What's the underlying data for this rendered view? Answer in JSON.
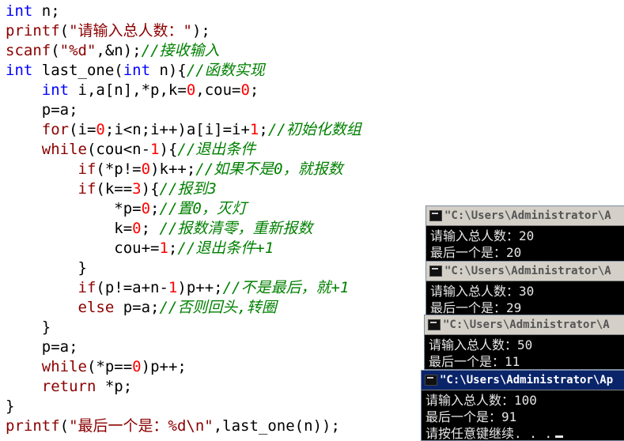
{
  "code_lines": [
    [
      {
        "t": "int",
        "c": "kw"
      },
      {
        "t": " n;",
        "c": "op"
      }
    ],
    [
      {
        "t": "printf",
        "c": "fn"
      },
      {
        "t": "(",
        "c": "op"
      },
      {
        "t": "\"请输入总人数：\"",
        "c": "str"
      },
      {
        "t": ");",
        "c": "op"
      }
    ],
    [
      {
        "t": "scanf",
        "c": "fn"
      },
      {
        "t": "(",
        "c": "op"
      },
      {
        "t": "\"%d\"",
        "c": "str"
      },
      {
        "t": ",&n);",
        "c": "op"
      },
      {
        "t": "//接收输入",
        "c": "cmt"
      }
    ],
    [
      {
        "t": "int",
        "c": "kw"
      },
      {
        "t": " last_one(",
        "c": "op"
      },
      {
        "t": "int",
        "c": "kw"
      },
      {
        "t": " n){",
        "c": "op"
      },
      {
        "t": "//函数实现",
        "c": "cmt"
      }
    ],
    [
      {
        "t": "    ",
        "c": "op"
      },
      {
        "t": "int",
        "c": "kw"
      },
      {
        "t": " i,a[n],*p,k=",
        "c": "op"
      },
      {
        "t": "0",
        "c": "num"
      },
      {
        "t": ",cou=",
        "c": "op"
      },
      {
        "t": "0",
        "c": "num"
      },
      {
        "t": ";",
        "c": "op"
      }
    ],
    [
      {
        "t": "    p=a;",
        "c": "op"
      }
    ],
    [
      {
        "t": "    ",
        "c": "op"
      },
      {
        "t": "for",
        "c": "fn"
      },
      {
        "t": "(i=",
        "c": "op"
      },
      {
        "t": "0",
        "c": "num"
      },
      {
        "t": ";i<n;i++)a[i]=i+",
        "c": "op"
      },
      {
        "t": "1",
        "c": "num"
      },
      {
        "t": ";",
        "c": "op"
      },
      {
        "t": "//初始化数组",
        "c": "cmt"
      }
    ],
    [
      {
        "t": "    ",
        "c": "op"
      },
      {
        "t": "while",
        "c": "fn"
      },
      {
        "t": "(cou<n-",
        "c": "op"
      },
      {
        "t": "1",
        "c": "num"
      },
      {
        "t": "){",
        "c": "op"
      },
      {
        "t": "//退出条件",
        "c": "cmt"
      }
    ],
    [
      {
        "t": "        ",
        "c": "op"
      },
      {
        "t": "if",
        "c": "fn"
      },
      {
        "t": "(*p!=",
        "c": "op"
      },
      {
        "t": "0",
        "c": "num"
      },
      {
        "t": ")k++;",
        "c": "op"
      },
      {
        "t": "//如果不是0，就报数",
        "c": "cmt"
      }
    ],
    [
      {
        "t": "        ",
        "c": "op"
      },
      {
        "t": "if",
        "c": "fn"
      },
      {
        "t": "(k==",
        "c": "op"
      },
      {
        "t": "3",
        "c": "num"
      },
      {
        "t": "){",
        "c": "op"
      },
      {
        "t": "//报到3",
        "c": "cmt"
      }
    ],
    [
      {
        "t": "            *p=",
        "c": "op"
      },
      {
        "t": "0",
        "c": "num"
      },
      {
        "t": ";",
        "c": "op"
      },
      {
        "t": "//置0，灭灯",
        "c": "cmt"
      }
    ],
    [
      {
        "t": "            k=",
        "c": "op"
      },
      {
        "t": "0",
        "c": "num"
      },
      {
        "t": "; ",
        "c": "op"
      },
      {
        "t": "//报数清零，重新报数",
        "c": "cmt"
      }
    ],
    [
      {
        "t": "            cou+=",
        "c": "op"
      },
      {
        "t": "1",
        "c": "num"
      },
      {
        "t": ";",
        "c": "op"
      },
      {
        "t": "//退出条件+1",
        "c": "cmt"
      }
    ],
    [
      {
        "t": "        }",
        "c": "op"
      }
    ],
    [
      {
        "t": "        ",
        "c": "op"
      },
      {
        "t": "if",
        "c": "fn"
      },
      {
        "t": "(p!=a+n-",
        "c": "op"
      },
      {
        "t": "1",
        "c": "num"
      },
      {
        "t": ")p++;",
        "c": "op"
      },
      {
        "t": "//不是最后，就+1",
        "c": "cmt"
      }
    ],
    [
      {
        "t": "        ",
        "c": "op"
      },
      {
        "t": "else",
        "c": "fn"
      },
      {
        "t": " p=a;",
        "c": "op"
      },
      {
        "t": "//否则回头,转圈",
        "c": "cmt"
      }
    ],
    [
      {
        "t": "    }",
        "c": "op"
      }
    ],
    [
      {
        "t": "    p=a;",
        "c": "op"
      }
    ],
    [
      {
        "t": "    ",
        "c": "op"
      },
      {
        "t": "while",
        "c": "fn"
      },
      {
        "t": "(*p==",
        "c": "op"
      },
      {
        "t": "0",
        "c": "num"
      },
      {
        "t": ")p++;",
        "c": "op"
      }
    ],
    [
      {
        "t": "    ",
        "c": "op"
      },
      {
        "t": "return",
        "c": "fn"
      },
      {
        "t": " *p;",
        "c": "op"
      }
    ],
    [
      {
        "t": "}",
        "c": "op"
      }
    ],
    [
      {
        "t": "printf",
        "c": "fn"
      },
      {
        "t": "(",
        "c": "op"
      },
      {
        "t": "\"最后一个是：%d\\n\"",
        "c": "str"
      },
      {
        "t": ",last_one(n));",
        "c": "op"
      }
    ]
  ],
  "consoles": [
    {
      "title": "\"C:\\Users\\Administrator\\A",
      "lines": [
        "请输入总人数：20",
        "最后一个是：20"
      ],
      "cursor": false
    },
    {
      "title": "\"C:\\Users\\Administrator\\A",
      "lines": [
        "请输入总人数：30",
        "最后一个是：29"
      ],
      "cursor": false
    },
    {
      "title": "\"C:\\Users\\Administrator\\A",
      "lines": [
        "请输入总人数：50",
        "最后一个是：11"
      ],
      "cursor": false
    },
    {
      "title": "\"C:\\Users\\Administrator\\Ap",
      "lines": [
        "请输入总人数：100",
        "最后一个是：91",
        "请按任意键继续. . ."
      ],
      "cursor": true
    }
  ]
}
